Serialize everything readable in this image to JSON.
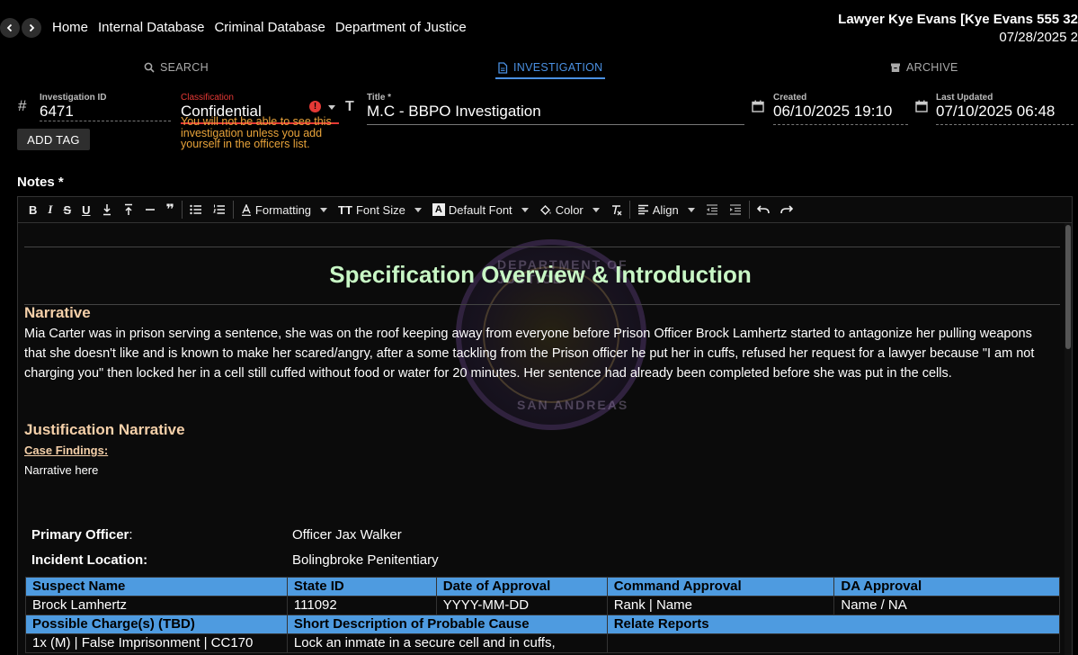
{
  "nav": {
    "back_icon": "chevron-left-icon",
    "forward_icon": "chevron-right-icon",
    "links": [
      "Home",
      "Internal Database",
      "Criminal Database",
      "Department of Justice"
    ]
  },
  "user": {
    "name": "Lawyer Kye Evans [Kye Evans 555 32",
    "date": "07/28/2025 2"
  },
  "tabs": [
    {
      "label": "SEARCH",
      "icon": "search-icon",
      "active": false
    },
    {
      "label": "INVESTIGATION",
      "icon": "document-icon",
      "active": true
    },
    {
      "label": "ARCHIVE",
      "icon": "archive-icon",
      "active": false
    }
  ],
  "fields": {
    "investigation_id_label": "Investigation ID",
    "investigation_id": "6471",
    "classification_label": "Classification",
    "classification": "Confidential",
    "classification_warning": "You will not be able to see this investigation unless you add yourself in the officers list.",
    "title_label": "Title *",
    "title": "M.C - BBPO Investigation",
    "created_label": "Created",
    "created": "06/10/2025 19:10",
    "updated_label": "Last Updated",
    "updated": "07/10/2025 06:48"
  },
  "add_tag_label": "ADD TAG",
  "notes_label": "Notes *",
  "toolbar": {
    "formatting": "Formatting",
    "font_size": "Font Size",
    "default_font": "Default Font",
    "color": "Color",
    "align": "Align"
  },
  "document": {
    "title": "Specification Overview & Introduction",
    "seal_text_top": "DEPARTMENT OF JUSTICE",
    "seal_text_bottom": "SAN ANDREAS",
    "narrative_heading": "Narrative",
    "narrative": "Mia Carter was in prison serving a sentence, she was on the roof keeping away from everyone before Prison Officer Brock Lamhertz started to antagonize her pulling weapons that she doesn't like and is known to make her scared/angry,  after a some tackling from the Prison officer he put her in cuffs, refused her request for a lawyer because \"I am not charging you\" then locked her in a cell still cuffed without food or water for 20 minutes.  Her sentence had already been completed before she was put in the cells.",
    "justification_heading": "Justification Narrative",
    "case_findings": "Case Findings:",
    "narrative_placeholder": "Narrative here",
    "primary_officer_label": "Primary Officer",
    "primary_officer_colon": ":",
    "primary_officer": "Officer Jax Walker",
    "incident_location_label": "Incident Location:",
    "incident_location": "Bolingbroke Penitentiary"
  },
  "table": {
    "header1": [
      "Suspect Name",
      "State ID",
      "Date of Approval",
      "Command Approval",
      "DA Approval"
    ],
    "row1": [
      "Brock Lamhertz",
      "111092",
      "YYYY-MM-DD",
      "Rank | Name",
      "Name / NA"
    ],
    "header2": [
      "Possible Charge(s) (TBD)",
      "Short Description of Probable Cause",
      "Relate Reports"
    ],
    "row2": [
      "1x (M) | False Imprisonment | CC170",
      "Lock an inmate in a secure cell and in cuffs,",
      ""
    ]
  },
  "colors": {
    "accent": "#4a90e2",
    "table_header": "#4e9be0",
    "doc_title": "#c8f7c5",
    "heading": "#f5d0a9",
    "warning": "#e8a33a",
    "error": "#e53935"
  }
}
